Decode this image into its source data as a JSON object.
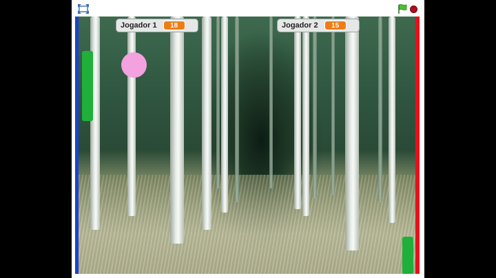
{
  "player": {
    "fullscreen_icon": "fullscreen-icon",
    "flag_icon": "green-flag-icon",
    "stop_icon": "stop-icon"
  },
  "monitors": [
    {
      "label": "Jogador 1",
      "value": "18"
    },
    {
      "label": "Jogador 2",
      "value": "15"
    }
  ],
  "colors": {
    "left_wall": "#1d44c8",
    "right_wall": "#e8101c",
    "paddle": "#1faf3a",
    "ball": "#f4a1e0",
    "monitor_value": "#ee7d16"
  }
}
